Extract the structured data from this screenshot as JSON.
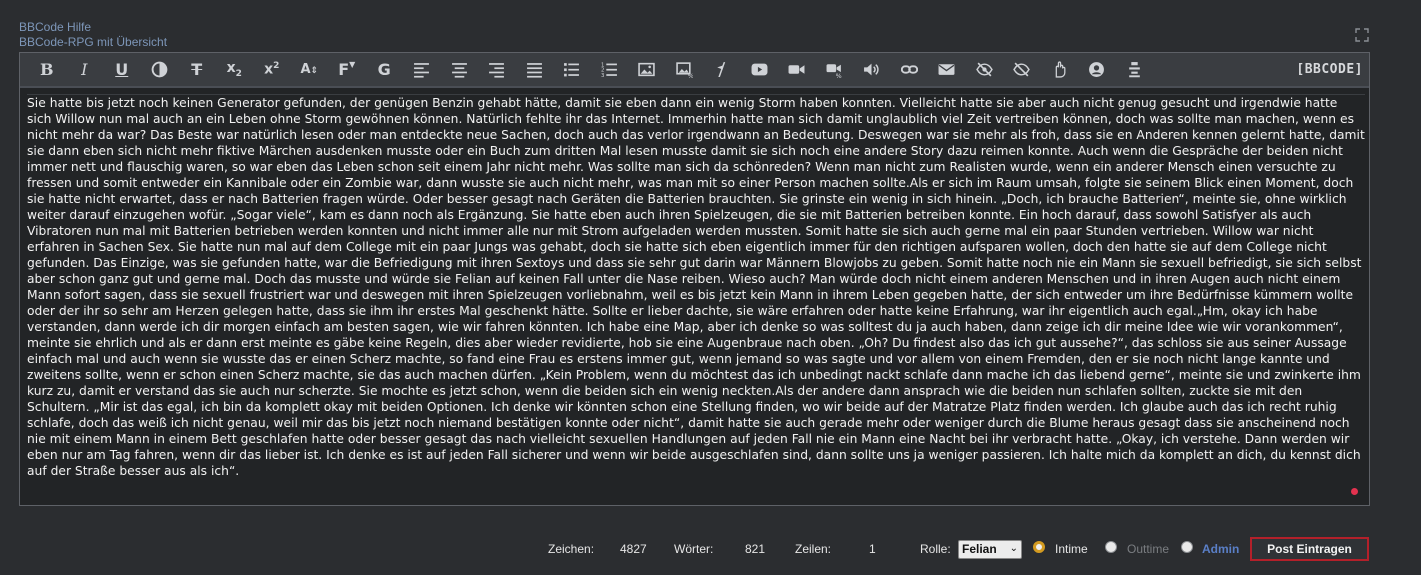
{
  "links": {
    "help": "BBCode Hilfe",
    "rpg": "BBCode-RPG mit Übersicht"
  },
  "toolbar": {
    "buttons": [
      {
        "name": "bold-icon",
        "glyph": "B"
      },
      {
        "name": "italic-icon",
        "glyph": "I"
      },
      {
        "name": "underline-icon",
        "glyph": "U"
      },
      {
        "name": "contrast-icon",
        "glyph": ""
      },
      {
        "name": "strikethrough-icon",
        "glyph": "T"
      },
      {
        "name": "subscript-icon",
        "glyph": "x₂"
      },
      {
        "name": "superscript-icon",
        "glyph": "x²"
      },
      {
        "name": "font-size-icon",
        "glyph": "A"
      },
      {
        "name": "font-family-icon",
        "glyph": "F"
      },
      {
        "name": "google-icon",
        "glyph": "G"
      },
      {
        "name": "align-left-icon",
        "glyph": ""
      },
      {
        "name": "align-center-icon",
        "glyph": ""
      },
      {
        "name": "align-right-icon",
        "glyph": ""
      },
      {
        "name": "align-justify-icon",
        "glyph": ""
      },
      {
        "name": "bullet-list-icon",
        "glyph": ""
      },
      {
        "name": "numbered-list-icon",
        "glyph": ""
      },
      {
        "name": "image-icon",
        "glyph": ""
      },
      {
        "name": "image-resize-icon",
        "glyph": ""
      },
      {
        "name": "flag-icon",
        "glyph": ""
      },
      {
        "name": "youtube-icon",
        "glyph": ""
      },
      {
        "name": "video-icon",
        "glyph": ""
      },
      {
        "name": "video-resize-icon",
        "glyph": ""
      },
      {
        "name": "audio-icon",
        "glyph": ""
      },
      {
        "name": "link-icon",
        "glyph": ""
      },
      {
        "name": "email-icon",
        "glyph": ""
      },
      {
        "name": "hide-icon",
        "glyph": ""
      },
      {
        "name": "hide-alt-icon",
        "glyph": ""
      },
      {
        "name": "hand-icon",
        "glyph": ""
      },
      {
        "name": "user-icon",
        "glyph": ""
      },
      {
        "name": "spoiler-icon",
        "glyph": ""
      }
    ],
    "bbcode_label": "[BBCODE]"
  },
  "editor": {
    "text": "Sie hatte bis jetzt noch keinen Generator gefunden, der genügen Benzin gehabt hätte, damit sie eben dann ein wenig Storm haben konnten. Vielleicht hatte sie aber auch nicht genug gesucht und irgendwie hatte sich Willow nun mal auch an ein Leben ohne Storm gewöhnen können. Natürlich fehlte ihr das Internet. Immerhin hatte man sich damit unglaublich viel Zeit vertreiben können, doch was sollte man machen, wenn es nicht mehr da war? Das Beste war natürlich lesen oder man entdeckte neue Sachen, doch auch das verlor irgendwann an Bedeutung. Deswegen war sie mehr als froh, dass sie en Anderen kennen gelernt hatte, damit sie dann eben sich nicht mehr fiktive Märchen ausdenken musste oder ein Buch zum dritten Mal lesen musste damit sie sich noch eine andere Story dazu reimen konnte. Auch wenn die Gespräche der beiden nicht immer nett und flauschig waren, so war eben das Leben schon seit einem Jahr nicht mehr. Was sollte man sich da schönreden? Wenn man nicht zum Realisten wurde, wenn ein anderer Mensch einen versuchte zu fressen und somit entweder ein Kannibale oder ein Zombie war, dann wusste sie auch nicht mehr, was man mit so einer Person machen sollte.Als er sich im Raum umsah, folgte sie seinem Blick einen Moment, doch sie hatte nicht erwartet, dass er nach Batterien fragen würde. Oder besser gesagt nach Geräten die Batterien brauchten. Sie grinste ein wenig in sich hinein. „Doch, ich brauche Batterien“, meinte sie, ohne wirklich weiter darauf einzugehen wofür. „Sogar viele“, kam es dann noch als Ergänzung. Sie hatte eben auch ihren Spielzeugen, die sie mit Batterien betreiben konnte. Ein hoch darauf, dass sowohl Satisfyer als auch Vibratoren nun mal mit Batterien betrieben werden konnten und nicht immer alle nur mit Strom aufgeladen werden mussten. Somit hatte sie sich auch gerne mal ein paar Stunden vertrieben. Willow war nicht erfahren in Sachen Sex. Sie hatte nun mal auf dem College mit ein paar Jungs was gehabt, doch sie hatte sich eben eigentlich immer für den richtigen aufsparen wollen, doch den hatte sie auf dem College nicht gefunden. Das Einzige, was sie gefunden hatte, war die Befriedigung mit ihren Sextoys und dass sie sehr gut darin war Männern Blowjobs zu geben. Somit hatte noch nie ein Mann sie sexuell befriedigt, sie sich selbst aber schon ganz gut und gerne mal. Doch das musste und würde sie Felian auf keinen Fall unter die Nase reiben. Wieso auch? Man würde doch nicht einem anderen Menschen und in ihren Augen auch nicht einem Mann sofort sagen, dass sie sexuell frustriert war und deswegen mit ihren Spielzeugen vorliebnahm, weil es bis jetzt kein Mann in ihrem Leben gegeben hatte, der sich entweder um ihre Bedürfnisse kümmern wollte oder der ihr so sehr am Herzen gelegen hatte, dass sie ihm ihr erstes Mal geschenkt hätte. Sollte er lieber dachte, sie wäre erfahren oder hatte keine Erfahrung, war ihr eigentlich auch egal.„Hm, okay ich habe verstanden, dann werde ich dir morgen einfach am besten sagen, wie wir fahren könnten. Ich habe eine Map, aber ich denke so was solltest du ja auch haben, dann zeige ich dir meine Idee wie wir vorankommen“, meinte sie ehrlich und als er dann erst meinte es gäbe keine Regeln, dies aber wieder revidierte, hob sie eine Augenbraue nach oben. „Oh? Du findest also das ich gut aussehe?“, das schloss sie aus seiner Aussage einfach mal und auch wenn sie wusste das er einen Scherz machte, so fand eine Frau es erstens immer gut, wenn jemand so was sagte und vor allem von einem Fremden, den er sie noch nicht lange kannte und zweitens sollte, wenn er schon einen Scherz machte, sie das auch machen dürfen. „Kein Problem, wenn du möchtest das ich unbedingt nackt schlafe dann mache ich das liebend gerne“, meinte sie und zwinkerte ihm kurz zu, damit er verstand das sie auch nur scherzte. Sie mochte es jetzt schon, wenn die beiden sich ein wenig neckten.Als der andere dann ansprach wie die beiden nun schlafen sollten, zuckte sie mit den Schultern. „Mir ist das egal, ich bin da komplett okay mit beiden Optionen. Ich denke wir könnten schon eine Stellung finden, wo wir beide auf der Matratze Platz finden werden. Ich glaube auch das ich recht ruhig schlafe, doch das weiß ich nicht genau, weil mir das bis jetzt noch niemand bestätigen konnte oder nicht“, damit hatte sie auch gerade mehr oder weniger durch die Blume heraus gesagt dass sie anscheinend noch nie mit einem Mann in einem Bett geschlafen hatte oder besser gesagt das nach vielleicht sexuellen Handlungen auf jeden Fall nie ein Mann eine Nacht bei ihr verbracht hatte. „Okay, ich verstehe. Dann werden wir eben nur am Tag fahren, wenn dir das lieber ist. Ich denke es ist auf jeden Fall sicherer und wenn wir beide ausgeschlafen sind, dann sollte uns ja weniger passieren. Ich halte mich da komplett an dich, du kennst dich auf der Straße besser aus als ich“."
  },
  "status": {
    "chars_label": "Zeichen:",
    "chars_value": "4827",
    "words_label": "Wörter:",
    "words_value": "821",
    "lines_label": "Zeilen:",
    "lines_value": "1",
    "role_label": "Rolle:",
    "role_value": "Felian",
    "opt_intime": "Intime",
    "opt_outtime": "Outtime",
    "opt_admin": "Admin",
    "post_button": "Post Eintragen"
  },
  "colors": {
    "accent_orange": "#d39b21",
    "admin_blue": "#5a7fc7",
    "post_border": "#b3202a",
    "link": "#7d96b8"
  }
}
